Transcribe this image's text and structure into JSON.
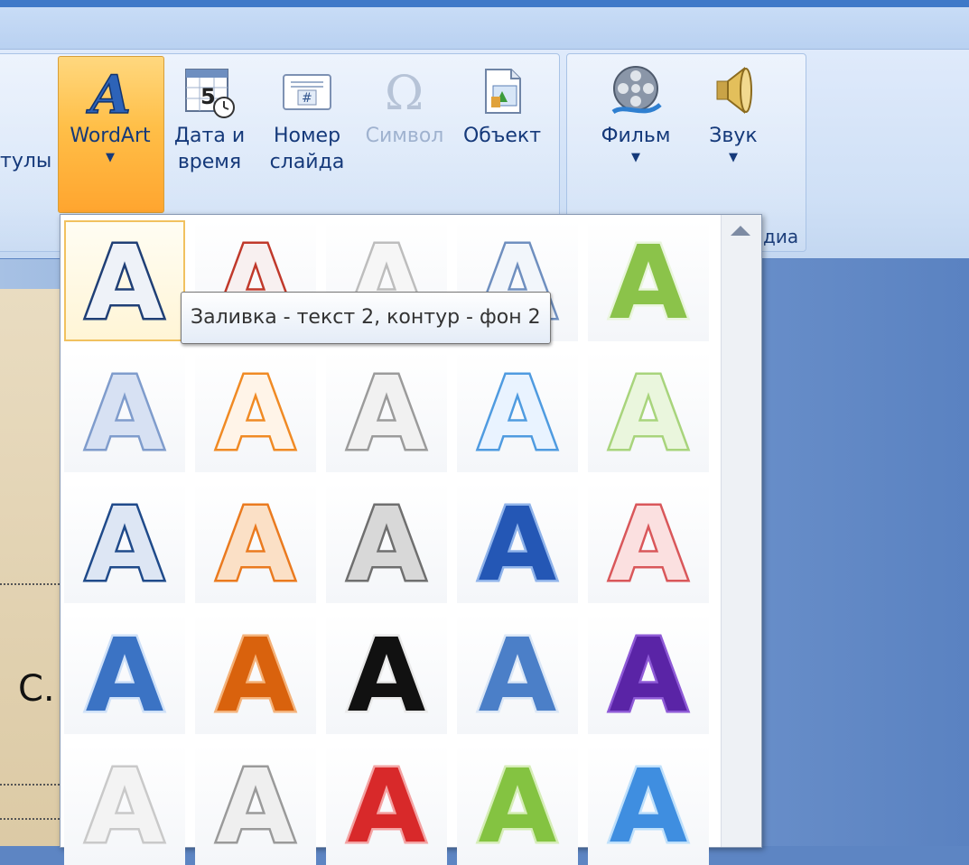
{
  "ribbon": {
    "partial_label": "тулы",
    "buttons": [
      {
        "label": "WordArt",
        "label2": "",
        "has_dropdown": true,
        "icon": "wordart-icon"
      },
      {
        "label": "Дата и",
        "label2": "время",
        "has_dropdown": false,
        "icon": "calendar-clock-icon"
      },
      {
        "label": "Номер",
        "label2": "слайда",
        "has_dropdown": false,
        "icon": "slide-number-icon"
      },
      {
        "label": "Символ",
        "label2": "",
        "has_dropdown": false,
        "disabled": true,
        "icon": "omega-icon"
      },
      {
        "label": "Объект",
        "label2": "",
        "has_dropdown": false,
        "icon": "object-icon"
      },
      {
        "label": "Фильм",
        "label2": "",
        "has_dropdown": true,
        "icon": "film-reel-icon"
      },
      {
        "label": "Звук",
        "label2": "",
        "has_dropdown": true,
        "icon": "speaker-icon"
      }
    ],
    "media_group_label": "диа"
  },
  "tooltip": {
    "text": "Заливка - текст 2, контур - фон 2"
  },
  "slide": {
    "text": "С."
  },
  "gallery": {
    "glyph": "A",
    "styles": [
      [
        {
          "fill": "#eef2f8",
          "stroke": "#1f3f76",
          "selected": true
        },
        {
          "fill": "#f8f0f0",
          "stroke": "#c0392b"
        },
        {
          "fill": "#f6f6f6",
          "stroke": "#bdbdbd"
        },
        {
          "fill": "#f2f6fb",
          "stroke": "#6f8fbf"
        },
        {
          "fill": "#8bc34a",
          "stroke": "#e9f5dc"
        }
      ],
      [
        {
          "fill": "#d7e1f3",
          "stroke": "#7f9ccc"
        },
        {
          "fill": "#fff4e8",
          "stroke": "#f08a24"
        },
        {
          "fill": "#f1f1f1",
          "stroke": "#9b9b9b"
        },
        {
          "fill": "#e9f3ff",
          "stroke": "#4f9be0"
        },
        {
          "fill": "#eaf6dd",
          "stroke": "#a8d47c"
        }
      ],
      [
        {
          "fill": "#dde6f4",
          "stroke": "#1f4a8a"
        },
        {
          "fill": "#fbe0c6",
          "stroke": "#ea7a1f"
        },
        {
          "fill": "#d8d8d8",
          "stroke": "#6f6f6f"
        },
        {
          "fill": "#2457b5",
          "stroke": "#8fb3ea"
        },
        {
          "fill": "#fbe0e0",
          "stroke": "#d9575a"
        }
      ],
      [
        {
          "fill": "#3b73c4",
          "stroke": "#cfe1f8"
        },
        {
          "fill": "#d9620d",
          "stroke": "#f4b27a"
        },
        {
          "fill": "#111111",
          "stroke": "#e9e9e9"
        },
        {
          "fill": "#4b7fc8",
          "stroke": "#dbe7f6"
        },
        {
          "fill": "#5a24a6",
          "stroke": "#8e5ad6"
        }
      ],
      [
        {
          "fill": "#f3f3f3",
          "stroke": "#c9c9c9"
        },
        {
          "fill": "#efefef",
          "stroke": "#9a9a9a"
        },
        {
          "fill": "#d8292a",
          "stroke": "#f3a3a3"
        },
        {
          "fill": "#84c341",
          "stroke": "#d6edb8"
        },
        {
          "fill": "#3f8ee0",
          "stroke": "#bfe0fb"
        }
      ]
    ]
  }
}
